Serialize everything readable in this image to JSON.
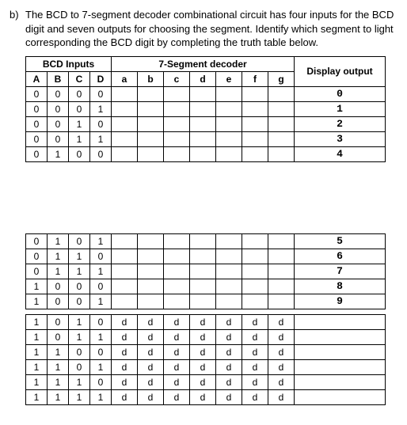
{
  "question": {
    "label": "b)",
    "text": "The BCD to 7-segment decoder combinational circuit has four inputs for the BCD digit and seven outputs for choosing the segment. Identify which segment to light corresponding the BCD digit by completing the truth table below."
  },
  "headers": {
    "bcd_group": "BCD Inputs",
    "seg_group": "7-Segment decoder",
    "disp": "Display output",
    "abcd": [
      "A",
      "B",
      "C",
      "D"
    ],
    "segs": [
      "a",
      "b",
      "c",
      "d",
      "e",
      "f",
      "g"
    ]
  },
  "rows_top": [
    {
      "A": "0",
      "B": "0",
      "C": "0",
      "D": "0",
      "a": "",
      "b": "",
      "c": "",
      "d": "",
      "e": "",
      "f": "",
      "g": "",
      "disp": "0"
    },
    {
      "A": "0",
      "B": "0",
      "C": "0",
      "D": "1",
      "a": "",
      "b": "",
      "c": "",
      "d": "",
      "e": "",
      "f": "",
      "g": "",
      "disp": "1"
    },
    {
      "A": "0",
      "B": "0",
      "C": "1",
      "D": "0",
      "a": "",
      "b": "",
      "c": "",
      "d": "",
      "e": "",
      "f": "",
      "g": "",
      "disp": "2"
    },
    {
      "A": "0",
      "B": "0",
      "C": "1",
      "D": "1",
      "a": "",
      "b": "",
      "c": "",
      "d": "",
      "e": "",
      "f": "",
      "g": "",
      "disp": "3"
    },
    {
      "A": "0",
      "B": "1",
      "C": "0",
      "D": "0",
      "a": "",
      "b": "",
      "c": "",
      "d": "",
      "e": "",
      "f": "",
      "g": "",
      "disp": "4"
    }
  ],
  "rows_mid": [
    {
      "A": "0",
      "B": "1",
      "C": "0",
      "D": "1",
      "a": "",
      "b": "",
      "c": "",
      "d": "",
      "e": "",
      "f": "",
      "g": "",
      "disp": "5"
    },
    {
      "A": "0",
      "B": "1",
      "C": "1",
      "D": "0",
      "a": "",
      "b": "",
      "c": "",
      "d": "",
      "e": "",
      "f": "",
      "g": "",
      "disp": "6"
    },
    {
      "A": "0",
      "B": "1",
      "C": "1",
      "D": "1",
      "a": "",
      "b": "",
      "c": "",
      "d": "",
      "e": "",
      "f": "",
      "g": "",
      "disp": "7"
    },
    {
      "A": "1",
      "B": "0",
      "C": "0",
      "D": "0",
      "a": "",
      "b": "",
      "c": "",
      "d": "",
      "e": "",
      "f": "",
      "g": "",
      "disp": "8"
    },
    {
      "A": "1",
      "B": "0",
      "C": "0",
      "D": "1",
      "a": "",
      "b": "",
      "c": "",
      "d": "",
      "e": "",
      "f": "",
      "g": "",
      "disp": "9"
    }
  ],
  "rows_bot": [
    {
      "A": "1",
      "B": "0",
      "C": "1",
      "D": "0",
      "a": "d",
      "b": "d",
      "c": "d",
      "d": "d",
      "e": "d",
      "f": "d",
      "g": "d",
      "disp": ""
    },
    {
      "A": "1",
      "B": "0",
      "C": "1",
      "D": "1",
      "a": "d",
      "b": "d",
      "c": "d",
      "d": "d",
      "e": "d",
      "f": "d",
      "g": "d",
      "disp": ""
    },
    {
      "A": "1",
      "B": "1",
      "C": "0",
      "D": "0",
      "a": "d",
      "b": "d",
      "c": "d",
      "d": "d",
      "e": "d",
      "f": "d",
      "g": "d",
      "disp": ""
    },
    {
      "A": "1",
      "B": "1",
      "C": "0",
      "D": "1",
      "a": "d",
      "b": "d",
      "c": "d",
      "d": "d",
      "e": "d",
      "f": "d",
      "g": "d",
      "disp": ""
    },
    {
      "A": "1",
      "B": "1",
      "C": "1",
      "D": "0",
      "a": "d",
      "b": "d",
      "c": "d",
      "d": "d",
      "e": "d",
      "f": "d",
      "g": "d",
      "disp": ""
    },
    {
      "A": "1",
      "B": "1",
      "C": "1",
      "D": "1",
      "a": "d",
      "b": "d",
      "c": "d",
      "d": "d",
      "e": "d",
      "f": "d",
      "g": "d",
      "disp": ""
    }
  ]
}
